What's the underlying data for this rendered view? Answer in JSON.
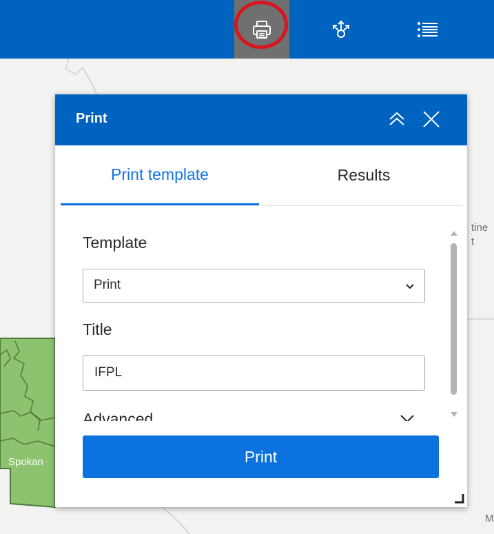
{
  "toolbar": {
    "tools": [
      {
        "id": "print",
        "icon": "printer-icon",
        "active": true
      },
      {
        "id": "share",
        "icon": "share-icon"
      },
      {
        "id": "layers",
        "icon": "layer-list-icon"
      }
    ],
    "background_color": "#0063bf",
    "highlight_color": "#d9141e"
  },
  "map": {
    "labels": {
      "city": "Spokan",
      "right_top": "tine",
      "right_mid": "t",
      "bottom_right": "M"
    },
    "region_color": "#8dc26f"
  },
  "panel": {
    "title": "Print",
    "tabs": [
      {
        "label": "Print template",
        "active": true
      },
      {
        "label": "Results",
        "active": false
      }
    ],
    "template": {
      "label": "Template",
      "selected": "Print"
    },
    "title_field": {
      "label": "Title",
      "value": "IFPL"
    },
    "advanced": {
      "label": "Advanced"
    },
    "print_button": {
      "label": "Print"
    },
    "accent_color": "#1473e6"
  }
}
